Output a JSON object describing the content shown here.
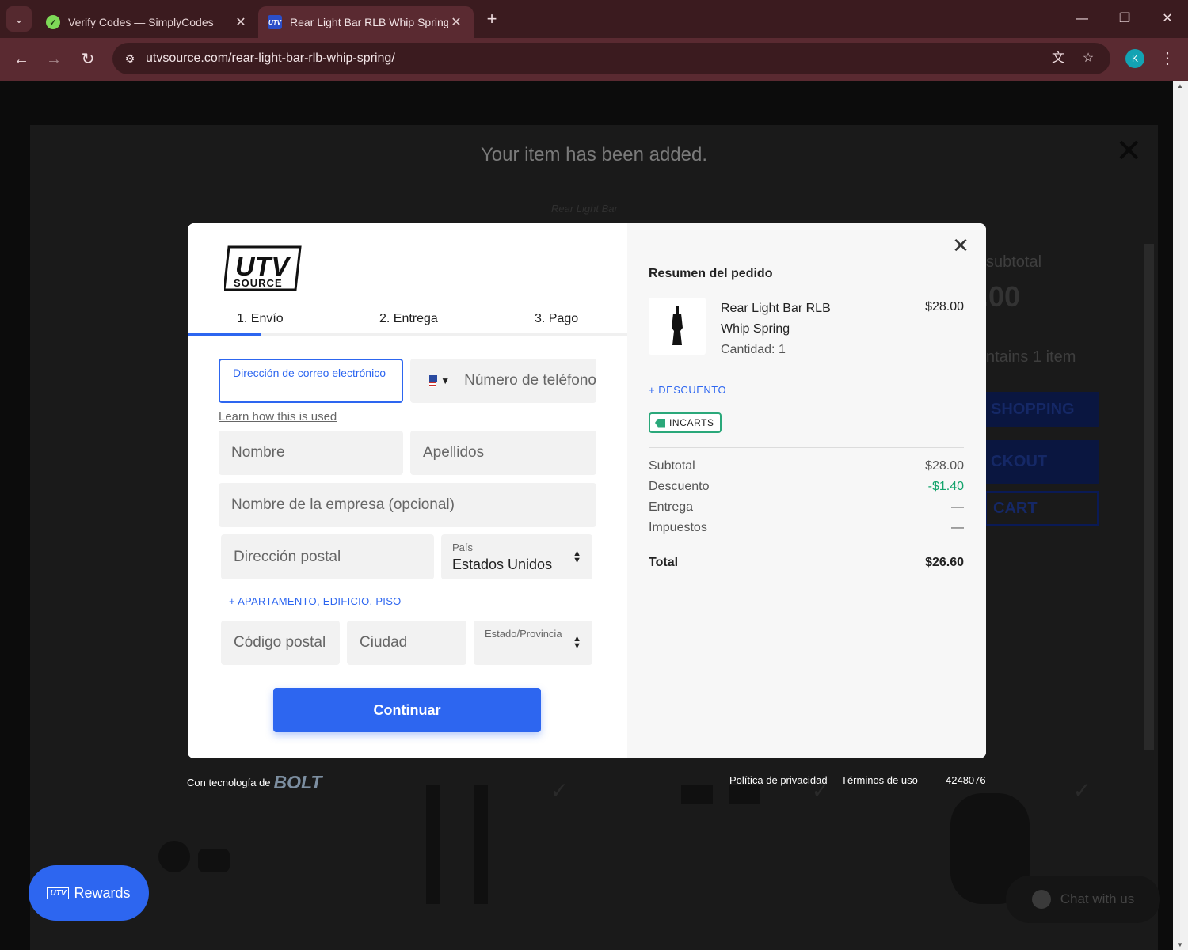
{
  "browser": {
    "tabs": [
      {
        "title": "Verify Codes — SimplyCodes",
        "favicon": "simplycodes-icon"
      },
      {
        "title": "Rear Light Bar RLB Whip Spring",
        "favicon": "utv-source-icon"
      }
    ],
    "url": "utvsource.com/rear-light-bar-rlb-whip-spring/",
    "profile_initial": "K",
    "accent_color": "#5a2a31"
  },
  "background_page": {
    "cart_message": "Your item has been added.",
    "product_caption": "Rear Light Bar",
    "subtotal_label": "subtotal",
    "subtotal_value": ".00",
    "contains_text": "ntains 1 item",
    "shopping_btn": "SHOPPING",
    "checkout_btn": "CKOUT",
    "cart_btn": "CART",
    "rewards_label": "Rewards",
    "rewards_logo": "UTV",
    "chat_label": "Chat with us"
  },
  "checkout": {
    "logo_text": "UTV SOURCE",
    "steps": [
      "1. Envío",
      "2. Entrega",
      "3. Pago"
    ],
    "active_step": 1,
    "email_label": "Dirección de correo electrónico",
    "phone_placeholder": "Número de teléfono",
    "learn_link": "Learn how this is used",
    "first_name": "Nombre",
    "last_name": "Apellidos",
    "company": "Nombre de la empresa (opcional)",
    "street": "Dirección postal",
    "country_label": "País",
    "country_value": "Estados Unidos",
    "apartment_link": "+ APARTAMENTO, EDIFICIO, PISO",
    "postal_code": "Código postal",
    "city": "Ciudad",
    "state_label": "Estado/Provincia",
    "continue_btn": "Continuar",
    "primary_color": "#2d66f0"
  },
  "summary": {
    "title": "Resumen del pedido",
    "product_name": "Rear Light Bar RLB Whip Spring",
    "quantity": "Cantidad: 1",
    "price": "$28.00",
    "discount_link": "+ DESCUENTO",
    "coupon_code": "INCARTS",
    "rows": [
      {
        "label": "Subtotal",
        "value": "$28.00"
      },
      {
        "label": "Descuento",
        "value": "-$1.40"
      },
      {
        "label": "Entrega",
        "value": "—"
      },
      {
        "label": "Impuestos",
        "value": "—"
      }
    ],
    "total_label": "Total",
    "total_value": "$26.60",
    "discount_color": "#14a46c"
  },
  "footer": {
    "powered_by": "Con tecnología de",
    "bolt_logo": "BOLT",
    "privacy": "Política de privacidad",
    "terms": "Términos de uso",
    "id": "4248076"
  }
}
